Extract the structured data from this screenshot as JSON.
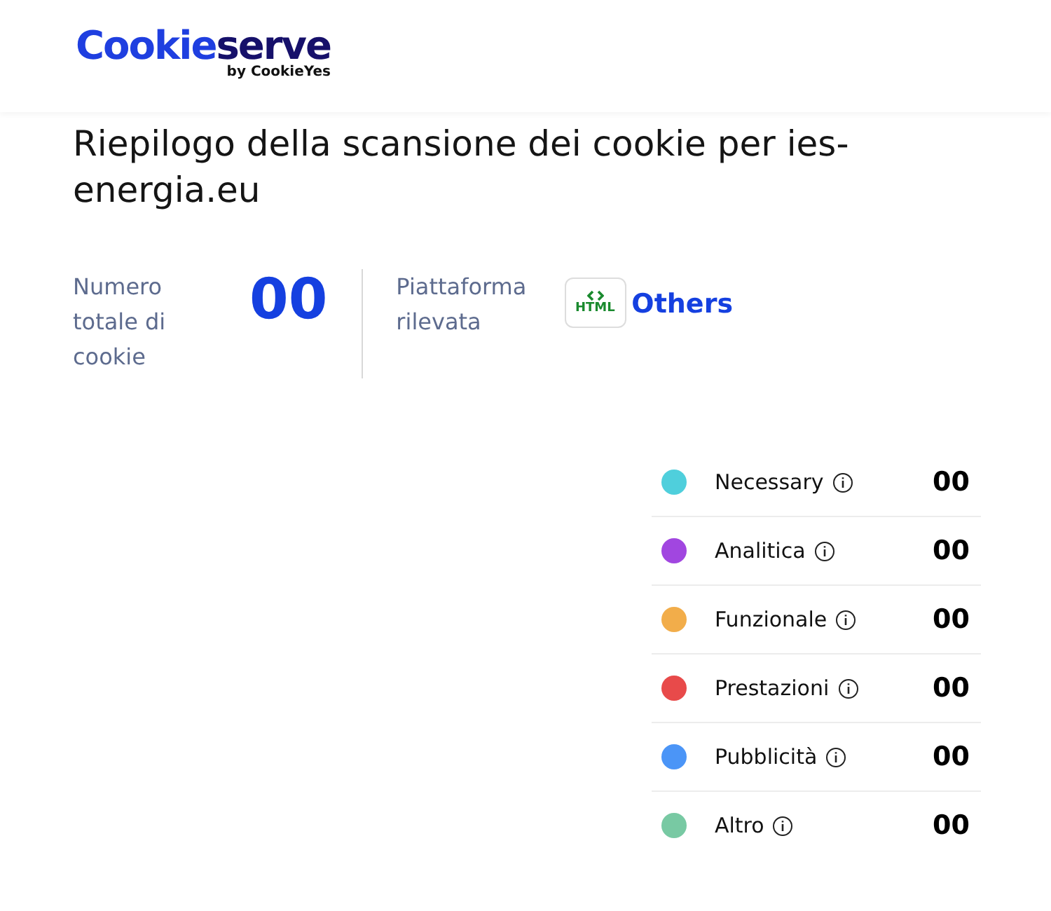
{
  "brand": {
    "name_first": "Cookie",
    "name_second": "serve",
    "tagline": "by CookieYes"
  },
  "title": "Riepilogo della scansione dei cookie per ies-energia.eu",
  "summary": {
    "total_label": "Numero totale di cookie",
    "total_value": "00",
    "platform_label": "Piattaforma rilevata",
    "platform_badge": "HTML",
    "platform_value": "Others"
  },
  "categories": [
    {
      "name": "Necessary",
      "count": "00",
      "color": "#4fcfdc"
    },
    {
      "name": "Analitica",
      "count": "00",
      "color": "#a146e0"
    },
    {
      "name": "Funzionale",
      "count": "00",
      "color": "#f2ad4a"
    },
    {
      "name": "Prestazioni",
      "count": "00",
      "color": "#e84a4a"
    },
    {
      "name": "Pubblicità",
      "count": "00",
      "color": "#4b95f7"
    },
    {
      "name": "Altro",
      "count": "00",
      "color": "#78c9a3"
    }
  ]
}
